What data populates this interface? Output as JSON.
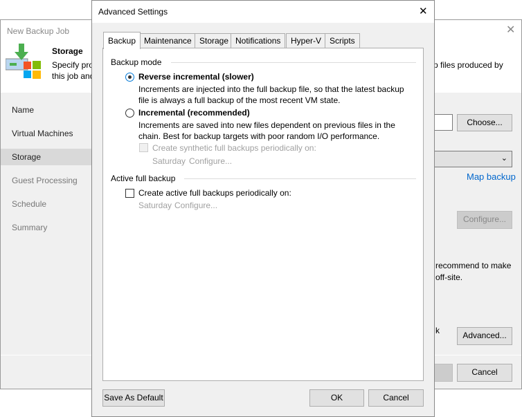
{
  "wizard": {
    "title": "New Backup Job",
    "step_title": "Storage",
    "desc_line1": "Specify pro",
    "desc_line2": "this job and",
    "desc_right": "p files produced by",
    "nav": [
      "Name",
      "Virtual Machines",
      "Storage",
      "Guest Processing",
      "Schedule",
      "Summary"
    ],
    "choose": "Choose...",
    "map_backup": "Map backup",
    "configure": "Configure...",
    "rec1": "recommend to make",
    "rec2": "off-site.",
    "ck": "k",
    "advanced": "Advanced...",
    "cancel": "Cancel"
  },
  "dialog": {
    "title": "Advanced Settings",
    "tabs": [
      "Backup",
      "Maintenance",
      "Storage",
      "Notifications",
      "Hyper-V",
      "Scripts"
    ],
    "backup_mode": "Backup mode",
    "reverse_label": "Reverse incremental (slower)",
    "reverse_desc1": "Increments are injected into the full backup file, so that the latest backup",
    "reverse_desc2": "file is always a full backup of the most recent VM state.",
    "inc_label": "Incremental (recommended)",
    "inc_desc1": "Increments are saved into new files dependent on previous files in the",
    "inc_desc2": "chain. Best for backup targets with poor random I/O performance.",
    "synthetic_label": "Create synthetic full backups periodically on:",
    "synthetic_day": "Saturday",
    "synthetic_configure": "Configure...",
    "active_full": "Active full backup",
    "active_label": "Create active full backups periodically on:",
    "active_day": "Saturday",
    "active_configure": "Configure...",
    "save_default": "Save As Default",
    "ok": "OK",
    "cancel": "Cancel"
  }
}
